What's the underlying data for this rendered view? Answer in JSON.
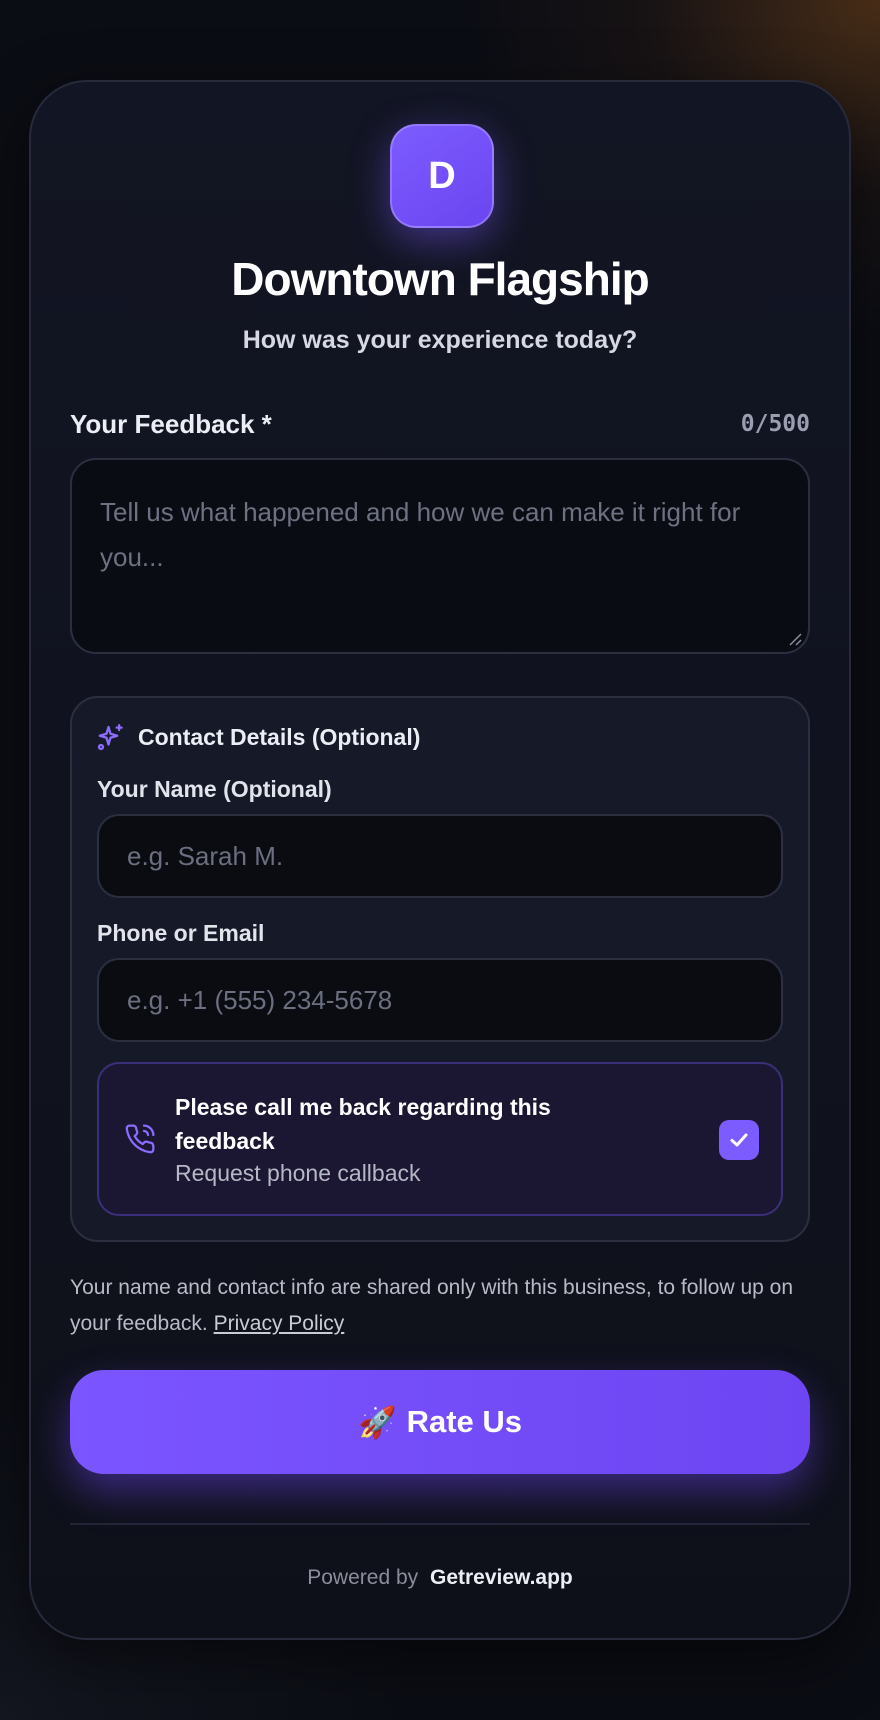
{
  "business": {
    "logo_letter": "D",
    "name": "Downtown Flagship",
    "prompt": "How was your experience today?"
  },
  "feedback": {
    "label": "Your Feedback *",
    "counter": "0/500",
    "value": "",
    "placeholder": "Tell us what happened and how we can make it right for you..."
  },
  "contact": {
    "heading": "Contact Details (Optional)",
    "icon": "sparkles-icon",
    "name_label": "Your Name (Optional)",
    "name_value": "",
    "name_placeholder": "e.g. Sarah M.",
    "phone_label": "Phone or Email",
    "phone_value": "",
    "phone_placeholder": "e.g. +1 (555) 234-5678",
    "callback": {
      "icon": "phone-icon",
      "title": "Please call me back regarding this feedback",
      "subtitle": "Request phone callback",
      "checked": true
    }
  },
  "privacy": {
    "text": "Your name and contact info are shared only with this business, to follow up on your feedback.",
    "link_label": "Privacy Policy"
  },
  "submit": {
    "emoji": "🚀",
    "label": "Rate Us"
  },
  "footer": {
    "prefix": "Powered by",
    "brand": "Getreview.app"
  },
  "colors": {
    "accent": "#7c5cff",
    "background": "#0b0d14",
    "card": "#121523"
  }
}
